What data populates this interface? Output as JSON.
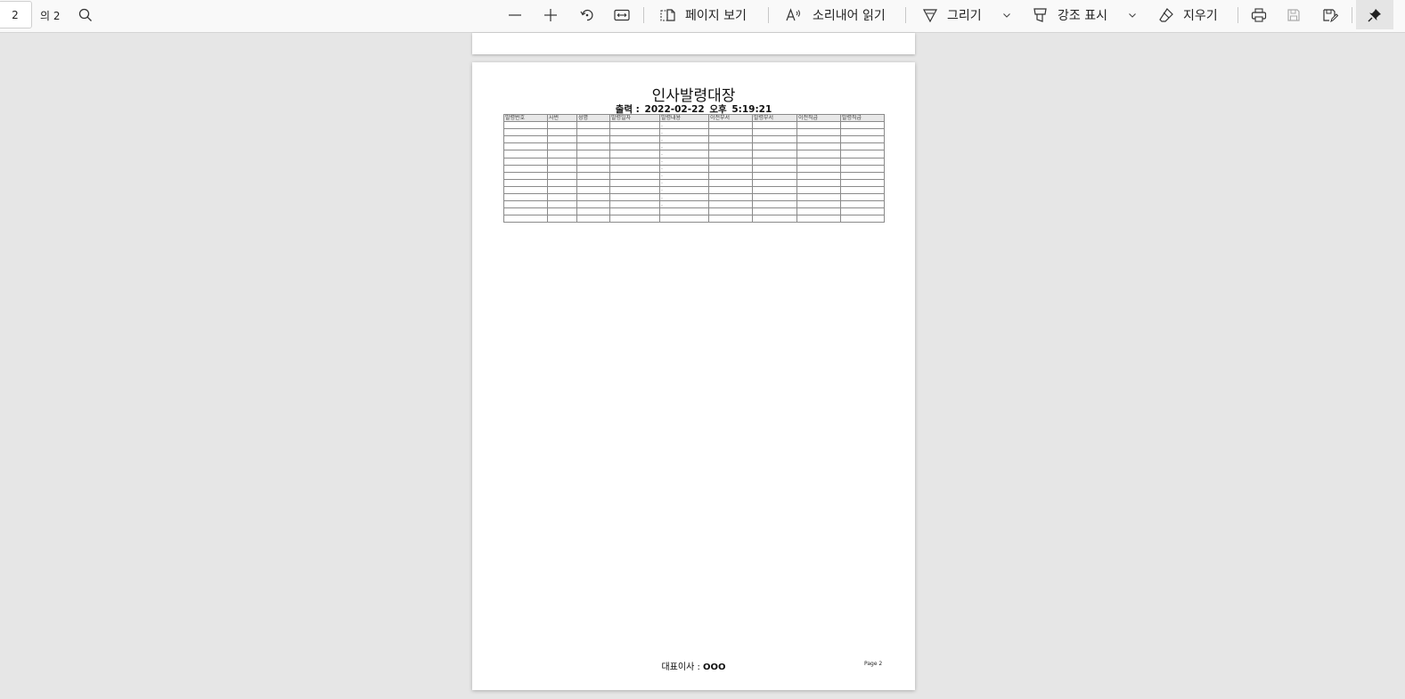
{
  "toolbar": {
    "page_number": "2",
    "page_of": "의 2",
    "page_view_label": "페이지 보기",
    "read_aloud_label": "소리내어 읽기",
    "draw_label": "그리기",
    "highlight_label": "강조 표시",
    "erase_label": "지우기"
  },
  "document": {
    "title": "인사발령대장",
    "print_label": "출력 :",
    "print_date": "2022-02-22",
    "print_ampm": "오후",
    "print_time": "5:19:21",
    "columns": [
      "발령번호",
      "사번",
      "성명",
      "발령일자",
      "발령내용",
      "이전부서",
      "발령부서",
      "이전직급",
      "발령직급"
    ],
    "row_dots": [
      ".",
      ".",
      ".",
      ".",
      ".",
      ".",
      ".",
      ".",
      ".",
      ".",
      ".",
      ".",
      "",
      ""
    ],
    "ceo_label": "대표이사 :",
    "ceo_name": "OOO",
    "page_label": "Page 2"
  }
}
